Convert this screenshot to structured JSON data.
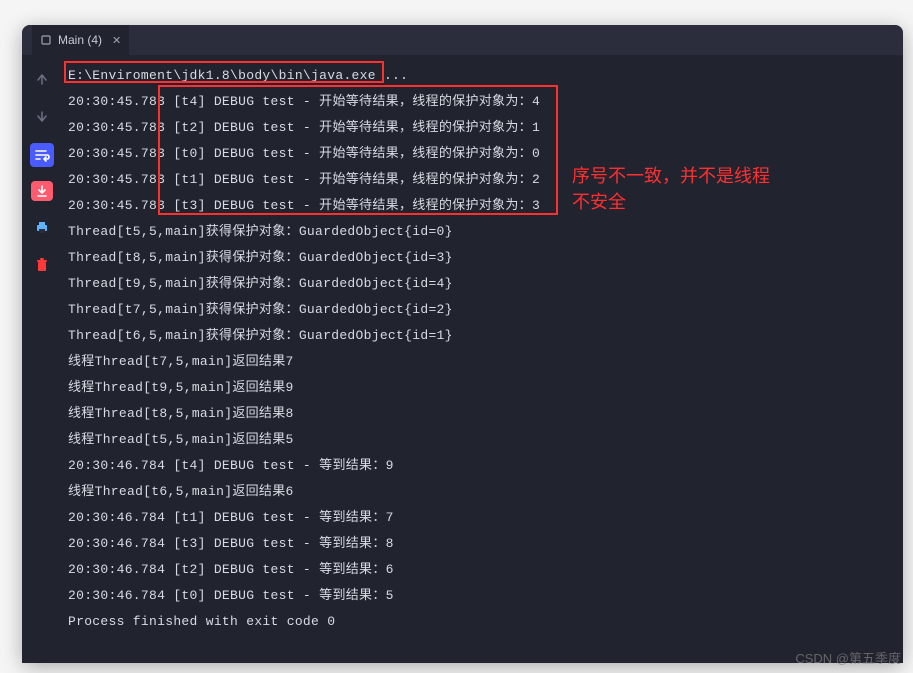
{
  "tab": {
    "label": "Main (4)"
  },
  "colors": {
    "bg": "#21232f",
    "text": "#d8dbe3",
    "accent": "#4a5bff",
    "danger": "#ff3030"
  },
  "gutter": {
    "items": [
      {
        "name": "arrow-up",
        "color": "#6b7185"
      },
      {
        "name": "arrow-down",
        "color": "#6b7185"
      },
      {
        "name": "wrap-lines",
        "color": "#ffffff",
        "active": true
      },
      {
        "name": "download",
        "color": "#ffffff",
        "redBg": true
      },
      {
        "name": "print",
        "color": "#5db3ff"
      },
      {
        "name": "trash",
        "color": "#ff3838"
      }
    ]
  },
  "lines": [
    "E:\\Enviroment\\jdk1.8\\body\\bin\\java.exe ...",
    "20:30:45.783 [t4] DEBUG test - 开始等待结果，线程的保护对象为：4",
    "20:30:45.783 [t2] DEBUG test - 开始等待结果，线程的保护对象为：1",
    "20:30:45.783 [t0] DEBUG test - 开始等待结果，线程的保护对象为：0",
    "20:30:45.783 [t1] DEBUG test - 开始等待结果，线程的保护对象为：2",
    "20:30:45.783 [t3] DEBUG test - 开始等待结果，线程的保护对象为：3",
    "Thread[t5,5,main]获得保护对象：GuardedObject{id=0}",
    "Thread[t8,5,main]获得保护对象：GuardedObject{id=3}",
    "Thread[t9,5,main]获得保护对象：GuardedObject{id=4}",
    "Thread[t7,5,main]获得保护对象：GuardedObject{id=2}",
    "Thread[t6,5,main]获得保护对象：GuardedObject{id=1}",
    "线程Thread[t7,5,main]返回结果7",
    "线程Thread[t9,5,main]返回结果9",
    "线程Thread[t8,5,main]返回结果8",
    "线程Thread[t5,5,main]返回结果5",
    "20:30:46.784 [t4] DEBUG test - 等到结果：9",
    "线程Thread[t6,5,main]返回结果6",
    "20:30:46.784 [t1] DEBUG test - 等到结果：7",
    "20:30:46.784 [t3] DEBUG test - 等到结果：8",
    "20:30:46.784 [t2] DEBUG test - 等到结果：6",
    "20:30:46.784 [t0] DEBUG test - 等到结果：5",
    "",
    "Process finished with exit code 0"
  ],
  "annotation": {
    "line1": "序号不一致，并不是线程",
    "line2": "不安全"
  },
  "watermark": "CSDN @第五季度"
}
